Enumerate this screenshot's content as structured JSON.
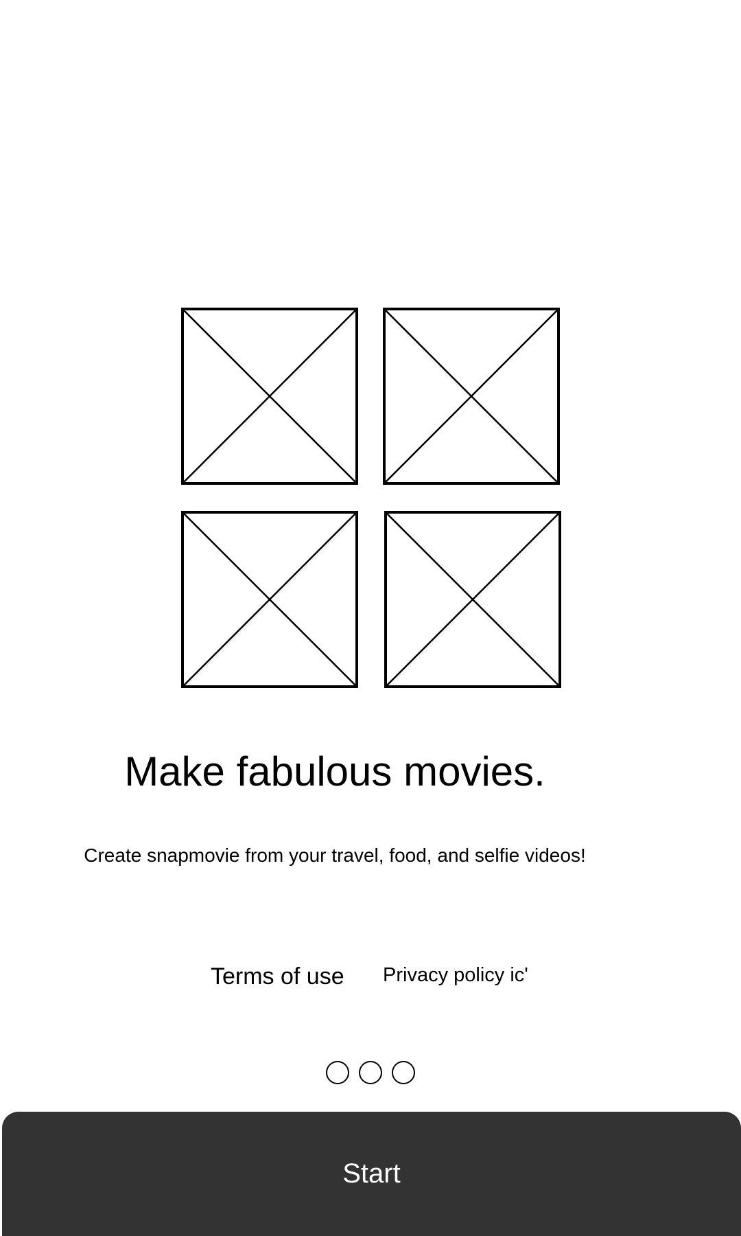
{
  "gallery": {
    "images": [
      {
        "icon": "image-placeholder-icon"
      },
      {
        "icon": "image-placeholder-icon"
      },
      {
        "icon": "image-placeholder-icon"
      },
      {
        "icon": "image-placeholder-icon"
      }
    ]
  },
  "headline": "Make fabulous movies.",
  "subtitle": "Create snapmovie from your travel, food, and selfie videos!",
  "links": {
    "terms": "Terms of use",
    "privacy": "Privacy policy ic'"
  },
  "pagination": {
    "total": 3
  },
  "start_button": {
    "label": "Start"
  },
  "colors": {
    "background": "#ffffff",
    "text": "#000000",
    "button_bg": "#333333",
    "button_text": "#ffffff"
  }
}
